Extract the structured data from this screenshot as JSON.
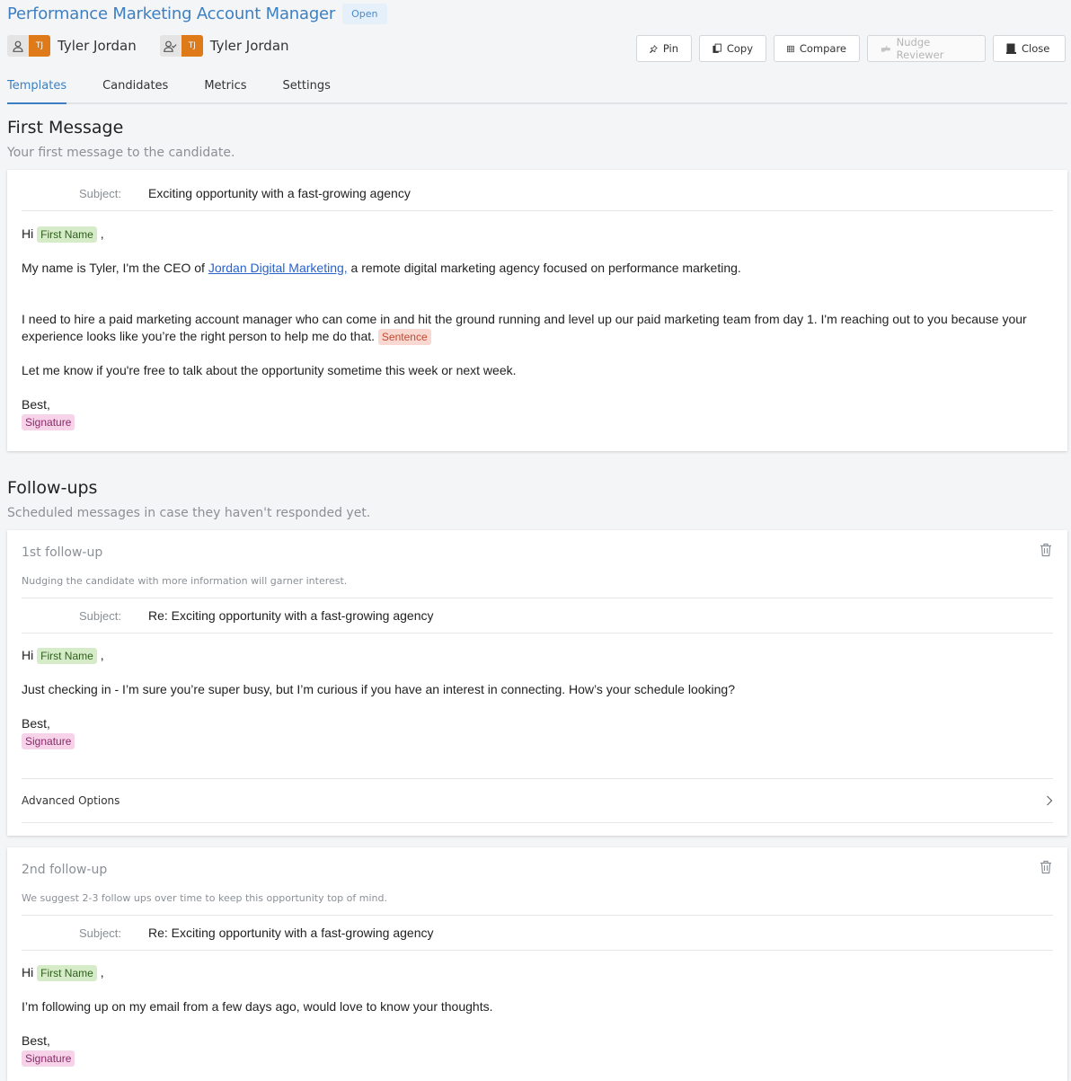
{
  "header": {
    "title": "Performance Marketing Account Manager",
    "status": "Open",
    "owners": [
      {
        "role_icon": "person-icon",
        "initials": "TJ",
        "name": "Tyler Jordan"
      },
      {
        "role_icon": "reviewer-icon",
        "initials": "TJ",
        "name": "Tyler Jordan"
      }
    ],
    "actions": {
      "pin": "Pin",
      "copy": "Copy",
      "compare": "Compare",
      "nudge": "Nudge Reviewer",
      "close": "Close"
    }
  },
  "tabs": [
    {
      "label": "Templates",
      "active": true
    },
    {
      "label": "Candidates",
      "active": false
    },
    {
      "label": "Metrics",
      "active": false
    },
    {
      "label": "Settings",
      "active": false
    }
  ],
  "first_message": {
    "title": "First Message",
    "subtitle": "Your first message to the candidate.",
    "subject_label": "Subject:",
    "subject": "Exciting opportunity with a fast-growing agency",
    "greeting": "Hi",
    "first_name_tag": "First Name",
    "comma": ",",
    "p1_before": "My name is Tyler, I'm the CEO of ",
    "p1_link": "Jordan Digital Marketing,",
    "p1_after": " a remote digital marketing agency focused on performance marketing.",
    "p2": "I need to hire a paid marketing account manager who can come in and hit the ground running and level up our paid marketing team from day 1. I'm reaching out to you because your experience looks like you’re the right person to help me do that.",
    "sentence_tag": "Sentence",
    "p3": "Let me know if you're free to talk about the opportunity sometime this week or next week.",
    "closing": "Best,",
    "signature_tag": "Signature"
  },
  "followups": {
    "title": "Follow-ups",
    "subtitle": "Scheduled messages in case they haven't responded yet.",
    "items": [
      {
        "title": "1st follow-up",
        "description": "Nudging the candidate with more information will garner interest.",
        "subject_label": "Subject:",
        "subject": "Re: Exciting opportunity with a fast-growing agency",
        "greeting": "Hi",
        "first_name_tag": "First Name",
        "comma": ",",
        "body": "Just checking in - I’m sure you’re super busy, but I’m curious if you have an interest in connecting. How’s your schedule looking?",
        "closing": "Best,",
        "signature_tag": "Signature",
        "advanced_options": "Advanced Options"
      },
      {
        "title": "2nd follow-up",
        "description": "We suggest 2-3 follow ups over time to keep this opportunity top of mind.",
        "subject_label": "Subject:",
        "subject": "Re: Exciting opportunity with a fast-growing agency",
        "greeting": "Hi",
        "first_name_tag": "First Name",
        "comma": ",",
        "body": "I’m following up on my email from a few days ago, would love to know your thoughts.",
        "closing": "Best,",
        "signature_tag": "Signature"
      }
    ]
  },
  "colors": {
    "accent": "#3d7fc1",
    "avatar": "#de7a17",
    "first_name_tag": "#d6ecc8",
    "sentence_tag": "#f8d8d0",
    "signature_tag": "#f7d3ea"
  }
}
